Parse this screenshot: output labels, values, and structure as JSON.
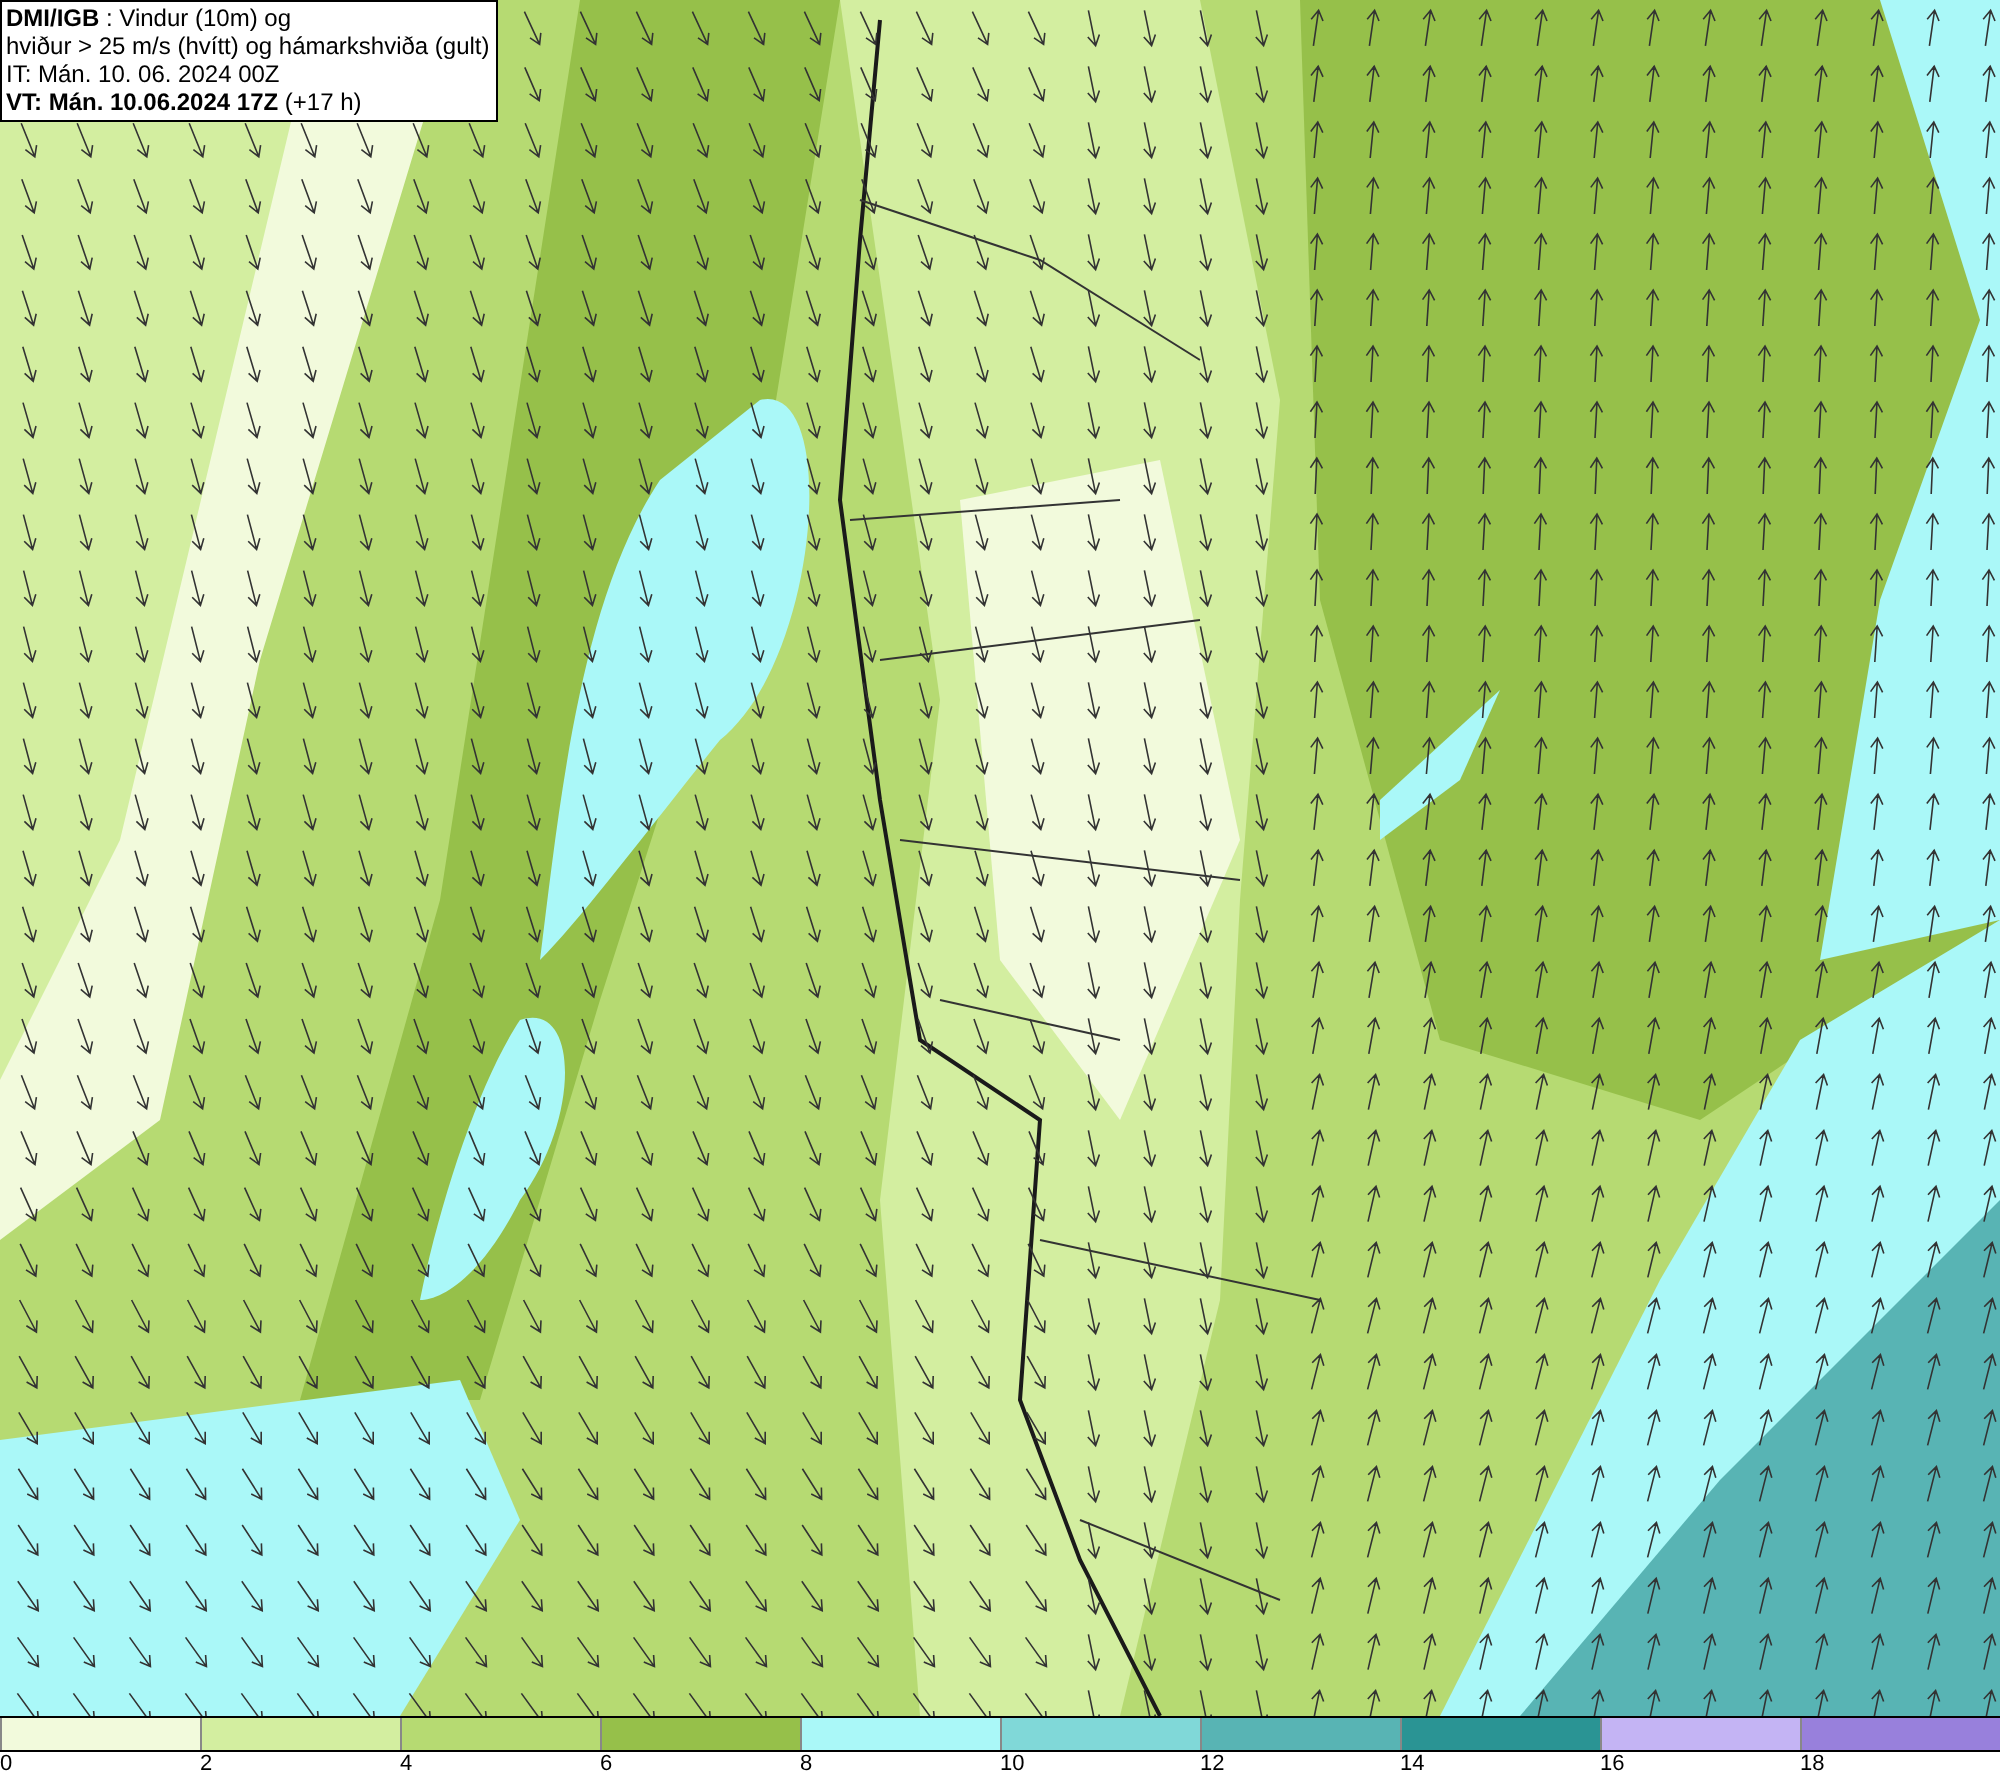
{
  "header": {
    "lines": [
      "**DMI/IGB** : Vindur (10m) og",
      "hviður > 25 m/s (hvítt) og hámarkshviða (gult)",
      "IT: Mán. 10. 06. 2024 00Z",
      "**VT: Mán. 10.06.2024 17Z** (+17 h)"
    ]
  },
  "legend": {
    "bins": [
      {
        "color": "#f2fadc"
      },
      {
        "color": "#d3eea0"
      },
      {
        "color": "#b6da72"
      },
      {
        "color": "#96c04a"
      },
      {
        "color": "#aaf8f8"
      },
      {
        "color": "#80d8d8"
      },
      {
        "color": "#58b4b4"
      },
      {
        "color": "#2a9494"
      },
      {
        "color": "#c4b4f4"
      },
      {
        "color": "#9880dc"
      }
    ],
    "ticks": [
      "0",
      "2",
      "4",
      "6",
      "8",
      "10",
      "12",
      "14",
      "16",
      "18"
    ]
  }
}
